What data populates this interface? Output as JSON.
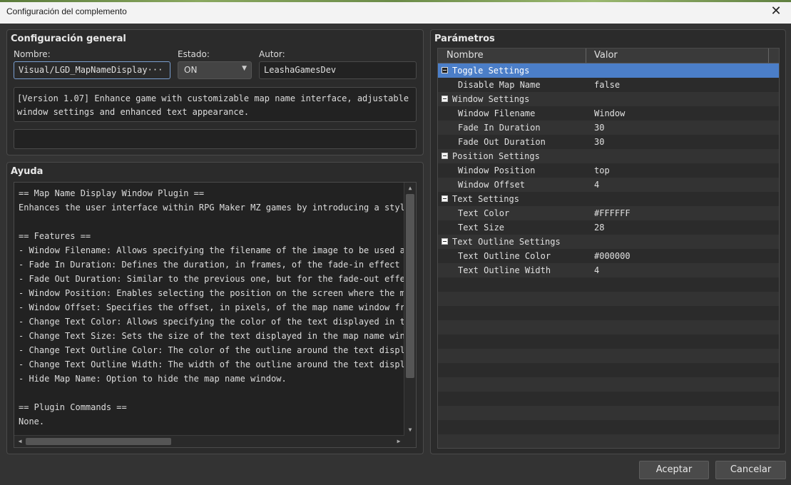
{
  "window": {
    "title": "Configuración del complemento",
    "close_glyph": "✕"
  },
  "general": {
    "title": "Configuración general",
    "name_label": "Nombre:",
    "name_value": "Visual/LGD_MapNameDisplay··· ···",
    "status_label": "Estado:",
    "status_value": "ON",
    "author_label": "Autor:",
    "author_value": "LeashaGamesDev",
    "description_lines": [
      "[Version 1.07] Enhance game with customizable map name interface, adjustable",
      "window settings and enhanced text appearance."
    ],
    "extra_value": ""
  },
  "help": {
    "title": "Ayuda",
    "lines": [
      "== Map Name Display Window Plugin ==",
      "Enhances the user interface within RPG Maker MZ games by introducing a stylis",
      "",
      "== Features ==",
      "- Window Filename: Allows specifying the filename of the image to be used as",
      "- Fade In Duration: Defines the duration, in frames, of the fade-in effect wh",
      "- Fade Out Duration: Similar to the previous one, but for the fade-out effect",
      "- Window Position: Enables selecting the position on the screen where the map",
      "- Window Offset: Specifies the offset, in pixels, of the map name window from",
      "- Change Text Color: Allows specifying the color of the text displayed in the",
      "- Change Text Size: Sets the size of the text displayed in the map name windo",
      "- Change Text Outline Color: The color of the outline around the text display",
      "- Change Text Outline Width: The width of the outline around the text display",
      "- Hide Map Name: Option to hide the map name window.",
      "",
      "== Plugin Commands ==",
      "None."
    ]
  },
  "params": {
    "title": "Parámetros",
    "col_name": "Nombre",
    "col_value": "Valor",
    "rows": [
      {
        "name": "Toggle Settings",
        "value": "",
        "group": true,
        "selected": true
      },
      {
        "name": "Disable Map Name",
        "value": "false",
        "group": false
      },
      {
        "name": "Window Settings",
        "value": "",
        "group": true
      },
      {
        "name": "Window Filename",
        "value": "Window",
        "group": false
      },
      {
        "name": "Fade In Duration",
        "value": "30",
        "group": false
      },
      {
        "name": "Fade Out Duration",
        "value": "30",
        "group": false
      },
      {
        "name": "Position Settings",
        "value": "",
        "group": true
      },
      {
        "name": "Window Position",
        "value": "top",
        "group": false
      },
      {
        "name": "Window Offset",
        "value": "4",
        "group": false
      },
      {
        "name": "Text Settings",
        "value": "",
        "group": true
      },
      {
        "name": "Text Color",
        "value": "#FFFFFF",
        "group": false
      },
      {
        "name": "Text Size",
        "value": "28",
        "group": false
      },
      {
        "name": "Text Outline Settings",
        "value": "",
        "group": true
      },
      {
        "name": "Text Outline Color",
        "value": "#000000",
        "group": false
      },
      {
        "name": "Text Outline Width",
        "value": "4",
        "group": false
      }
    ]
  },
  "buttons": {
    "ok": "Aceptar",
    "cancel": "Cancelar"
  },
  "colors": {
    "selection": "#4b7ec8",
    "background": "#2d2d2d"
  }
}
